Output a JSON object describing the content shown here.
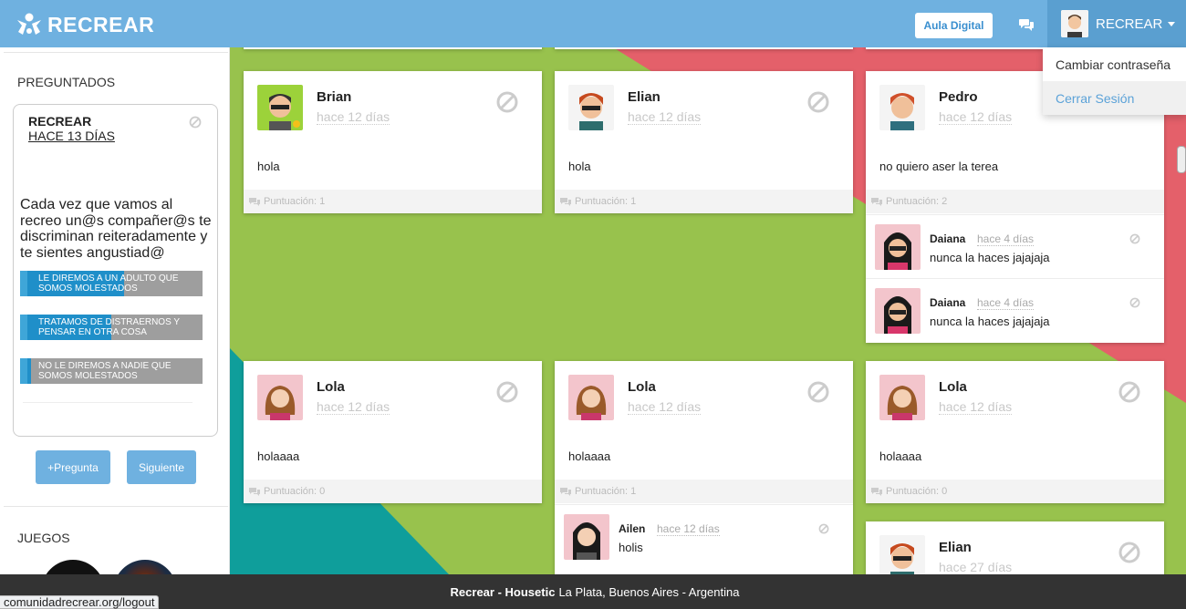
{
  "header": {
    "logo_text": "RECREAR",
    "aula_button": "Aula Digital",
    "user_name": "RECREAR",
    "dropdown": [
      "Cambiar contraseña",
      "Cerrar Sesión"
    ]
  },
  "sidebar": {
    "preguntados_heading": "PREGUNTADOS",
    "question": {
      "author": "RECREAR",
      "time": "HACE 13 DÍAS",
      "text": "Cada vez que vamos al recreo un@s compañer@s te discriminan reiteradamente y te sientes angustiad@",
      "options": [
        {
          "label": "LE DIREMOS A UN ADULTO QUE SOMOS MOLESTADOS",
          "percent": 57
        },
        {
          "label": "TRATAMOS DE DISTRAERNOS Y PENSAR EN OTRA COSA",
          "percent": 50
        },
        {
          "label": "NO LE DIREMOS A NADIE QUE SOMOS MOLESTADOS",
          "percent": 6
        }
      ]
    },
    "buttons": {
      "new_question": "+Pregunta",
      "next": "Siguiente"
    },
    "juegos_heading": "JUEGOS"
  },
  "posts": [
    {
      "author": "Brian",
      "time": "hace 12 días",
      "text": "hola",
      "score": "Puntuación: 1",
      "replies": []
    },
    {
      "author": "Elian",
      "time": "hace 12 días",
      "text": "hola",
      "score": "Puntuación: 1",
      "replies": []
    },
    {
      "author": "Pedro",
      "time": "hace 12 días",
      "text": "no quiero aser la terea",
      "score": "Puntuación: 2",
      "replies": [
        {
          "author": "Daiana",
          "time": "hace 4 días",
          "text": "nunca la haces jajajaja"
        },
        {
          "author": "Daiana",
          "time": "hace 4 días",
          "text": "nunca la haces jajajaja"
        }
      ]
    },
    {
      "author": "Lola",
      "time": "hace 12 días",
      "text": "holaaaa",
      "score": "Puntuación: 0",
      "replies": []
    },
    {
      "author": "Lola",
      "time": "hace 12 días",
      "text": "holaaaa",
      "score": "Puntuación: 1",
      "replies": [
        {
          "author": "Ailen",
          "time": "hace 12 días",
          "text": "holis"
        }
      ]
    },
    {
      "author": "Lola",
      "time": "hace 12 días",
      "text": "holaaaa",
      "score": "Puntuación: 0",
      "replies": []
    },
    {
      "author": "Elian",
      "time": "hace 27 días",
      "text": "",
      "score": "",
      "replies": []
    }
  ],
  "footer": {
    "brand": "Recrear - Housetic",
    "location": "La Plata, Buenos Aires - Argentina"
  },
  "status_url": "comunidadrecrear.org/logout",
  "colors": {
    "header": "#6fb1e0",
    "accent": "#5ba2d8",
    "bg_red": "#e4606a",
    "bg_green": "#98c24d",
    "bg_teal": "#0f9e9b",
    "footer": "#333333"
  }
}
